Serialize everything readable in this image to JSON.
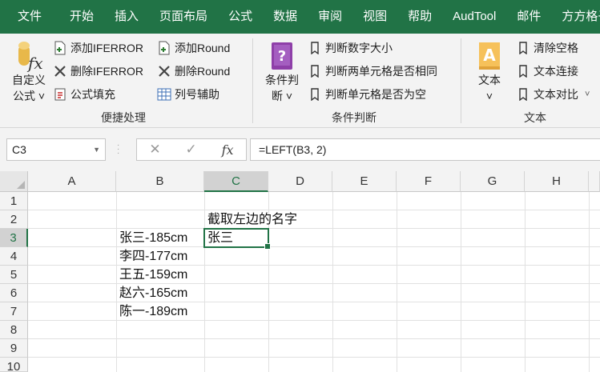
{
  "tabs": [
    "文件",
    "开始",
    "插入",
    "页面布局",
    "公式",
    "数据",
    "审阅",
    "视图",
    "帮助",
    "AudTool",
    "邮件",
    "方方格子"
  ],
  "ribbon": {
    "group1": {
      "big_button": {
        "line1": "自定义",
        "line2": "公式 ˅"
      },
      "buttons": [
        "添加IFERROR",
        "删除IFERROR",
        "公式填充",
        "添加Round",
        "删除Round",
        "列号辅助"
      ],
      "label": "便捷处理"
    },
    "group2": {
      "big_button": {
        "line1": "条件判",
        "line2": "断 ˅"
      },
      "buttons": [
        "判断数字大小",
        "判断两单元格是否相同",
        "判断单元格是否为空"
      ],
      "label": "条件判断"
    },
    "group3": {
      "big_button": {
        "line1": "文本",
        "line2": "˅"
      },
      "buttons": [
        "清除空格",
        "文本连接",
        "文本对比"
      ],
      "label": "文本"
    },
    "colors": {
      "tab_bar": "#217346",
      "ribbon_bg": "#f3f3f3",
      "accent": "#217346"
    }
  },
  "formula_bar": {
    "name_box": "C3",
    "cancel_icon": "✕",
    "enter_icon": "✓",
    "fx_label": "fx",
    "formula": "=LEFT(B3, 2)"
  },
  "sheet": {
    "columns": [
      "A",
      "B",
      "C",
      "D",
      "E",
      "F",
      "G",
      "H"
    ],
    "rows": [
      "1",
      "2",
      "3",
      "4",
      "5",
      "6",
      "7",
      "8",
      "9",
      "10"
    ],
    "selected_cell": "C3",
    "cells": {
      "C2": "截取左边的名字",
      "B3": "张三-185cm",
      "C3": "张三",
      "B4": "李四-177cm",
      "B5": "王五-159cm",
      "B6": "赵六-165cm",
      "B7": "陈一-189cm"
    }
  }
}
